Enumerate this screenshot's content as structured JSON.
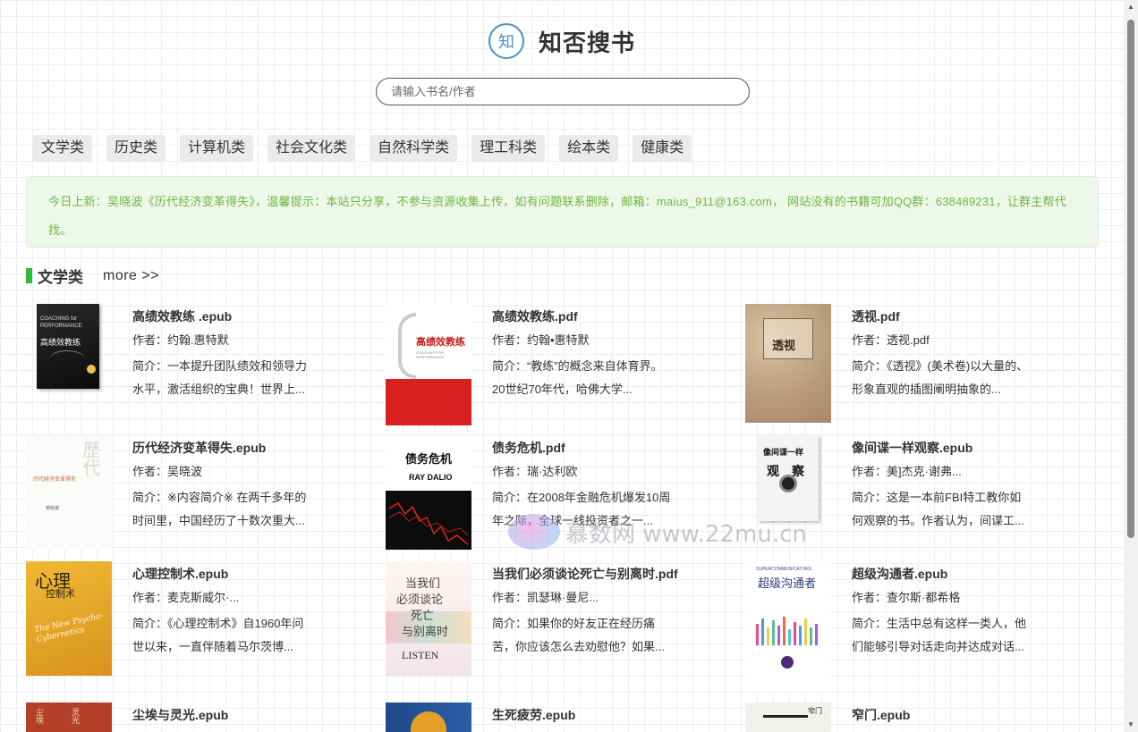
{
  "header": {
    "logo_glyph": "知",
    "site_title": "知否搜书"
  },
  "search": {
    "placeholder": "请输入书名/作者",
    "value": ""
  },
  "categories": [
    "文学类",
    "历史类",
    "计算机类",
    "社会文化类",
    "自然科学类",
    "理工科类",
    "绘本类",
    "健康类"
  ],
  "notice": {
    "text": "今日上新：吴晓波《历代经济变革得失》，温馨提示：本站只分享，不参与资源收集上传，如有问题联系删除，邮箱：maius_911@163.com，  网站没有的书籍可加QQ群：638489231，让群主帮代找。"
  },
  "section": {
    "title": "文学类",
    "more_label": "more >>"
  },
  "books": [
    {
      "title": "高绩效教练 .epub",
      "author": "作者：约翰.惠特默",
      "desc": "简介：一本提升团队绩效和领导力水平，激活组织的宝典！世界上..."
    },
    {
      "title": "高绩效教练.pdf",
      "author": "作者：约翰•惠特默",
      "desc": "简介：“教练”的概念来自体育界。20世纪70年代，哈佛大学..."
    },
    {
      "title": "透视.pdf",
      "author": "作者：透视.pdf",
      "desc": "简介：《透视》(美术卷)以大量的、形象直观的插图阐明抽象的..."
    },
    {
      "title": "历代经济变革得失.epub",
      "author": "作者：吴晓波",
      "desc": "简介：※内容简介※ 在两千多年的时间里，中国经历了十数次重大..."
    },
    {
      "title": "债务危机.pdf",
      "author": "作者：瑞·达利欧",
      "desc": "简介：在2008年金融危机爆发10周年之际，全球一线投资者之一..."
    },
    {
      "title": "像间谍一样观察.epub",
      "author": "作者：美]杰克·谢弗...",
      "desc": "简介：这是一本前FBI特工教你如何观察的书。作者认为，间谍工..."
    },
    {
      "title": "心理控制术.epub",
      "author": "作者：麦克斯威尔·...",
      "desc": "简介：《心理控制术》自1960年问世以来，一直伴随着马尔茨博..."
    },
    {
      "title": "当我们必须谈论死亡与别离时.pdf",
      "author": "作者：凯瑟琳·曼尼...",
      "desc": "简介：如果你的好友正在经历痛苦，你应该怎么去劝慰他？如果..."
    },
    {
      "title": "超级沟通者.epub",
      "author": "作者：查尔斯·都希格",
      "desc": "简介：生活中总有这样一类人，他们能够引导对话走向并达成对话..."
    },
    {
      "title": "尘埃与灵光.epub",
      "author": "",
      "desc": ""
    },
    {
      "title": "生死疲劳.epub",
      "author": "",
      "desc": ""
    },
    {
      "title": "窄门.epub",
      "author": "",
      "desc": ""
    }
  ],
  "covers": {
    "c1": {
      "line1": "COACHING for",
      "line2": "PERFORMANCE",
      "line3": "高绩效教练"
    },
    "c2": {
      "line1": "高绩效教练",
      "line2": "COACHING FOR PERFORMANCE"
    },
    "c3": {
      "line1": "透视"
    },
    "c4": {
      "line1": "历代经济变革得失",
      "line2": "吴晓波"
    },
    "c5": {
      "line1": "债务危机",
      "line2": "RAY DALIO"
    },
    "c6": {
      "line1": "像间谍一样",
      "line2": "观察"
    },
    "c7": {
      "line1": "心理",
      "line2": "控制术",
      "line3": "The New Psycho-Cybernetics"
    },
    "c8": {
      "line1": "当我们",
      "line2": "必须谈论",
      "line3": "死亡",
      "line4": "与别离时",
      "line5": "LISTEN"
    },
    "c9": {
      "line1": "SUPERCOMMUNICATORS",
      "line2": "超级沟通者"
    },
    "c12": {
      "line1": "窄门"
    }
  },
  "watermark": {
    "text": "慕数网 www.22mu.cn"
  },
  "colors": {
    "accent_green": "#2bbd3a",
    "notice_text": "#6db63e",
    "notice_bg": "#eef8ea",
    "logo_blue": "#4a90c8"
  }
}
